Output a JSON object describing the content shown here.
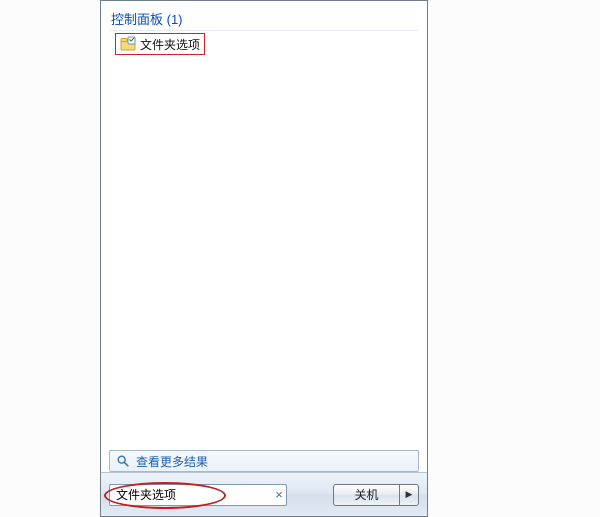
{
  "category": {
    "label": "控制面板 (1)"
  },
  "results": [
    {
      "label": "文件夹选项"
    }
  ],
  "more_results": {
    "label": "查看更多结果"
  },
  "search": {
    "value": "文件夹选项",
    "clear_glyph": "×"
  },
  "shutdown": {
    "label": "关机",
    "arrow_glyph": "▶"
  }
}
